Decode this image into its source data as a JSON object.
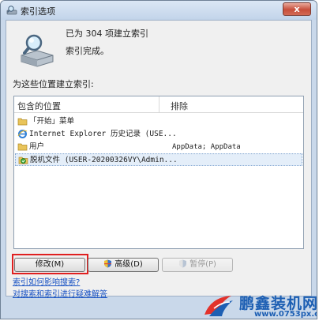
{
  "window": {
    "title": "索引选项",
    "close_label": "x"
  },
  "status": {
    "indexed_line": "已为 304 项建立索引",
    "complete_line": "索引完成。"
  },
  "locations": {
    "heading": "为这些位置建立索引:",
    "columns": [
      "包含的位置",
      "排除"
    ],
    "rows": [
      {
        "icon": "folder-icon",
        "name": "「开始」菜单",
        "exclude": "",
        "selected": false
      },
      {
        "icon": "ie-icon",
        "name": "Internet Explorer 历史记录 (USE...",
        "exclude": "",
        "selected": false
      },
      {
        "icon": "folder-icon",
        "name": "用户",
        "exclude": "AppData; AppData",
        "selected": false
      },
      {
        "icon": "offline-files-icon",
        "name": "脱机文件 (USER-20200326VY\\Admin...",
        "exclude": "",
        "selected": true
      }
    ]
  },
  "buttons": {
    "modify": "修改(M)",
    "advanced": "高级(D)",
    "pause": "暂停(P)"
  },
  "links": {
    "how_affects": "索引如何影响搜索?",
    "troubleshoot": "对搜索和索引进行疑难解答"
  },
  "watermark": {
    "title": "鹏鑫装机网",
    "url": "www.0753px.com"
  },
  "colors": {
    "highlight_box": "#e02020",
    "link": "#1a53c4",
    "watermark": "#1d5fb3"
  }
}
